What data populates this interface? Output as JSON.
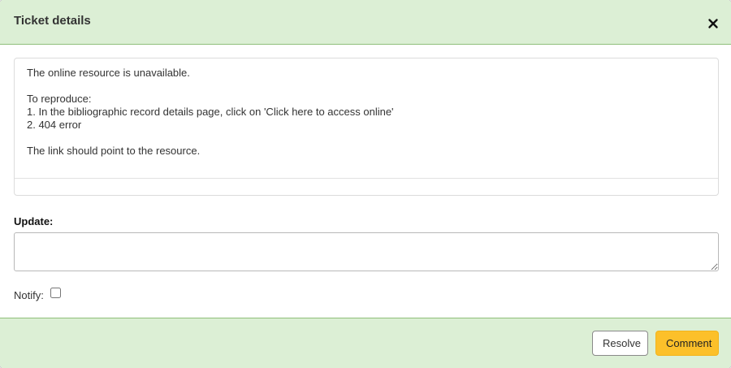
{
  "modal": {
    "title": "Ticket details",
    "close_label": "×"
  },
  "ticket": {
    "lines": [
      "The online resource is unavailable.",
      "",
      "To reproduce:",
      "1. In the bibliographic record details page, click on 'Click here to access online'",
      "2. 404 error",
      "",
      "The link should point to the resource."
    ]
  },
  "form": {
    "update_label": "Update:",
    "update_value": "",
    "notify_label": "Notify:",
    "notify_checked": false
  },
  "footer": {
    "resolve_label": "Resolve",
    "comment_label": "Comment"
  },
  "colors": {
    "header_bg": "#dcefd5",
    "header_border": "#8fbf7a",
    "comment_button": "#fcc02a"
  }
}
